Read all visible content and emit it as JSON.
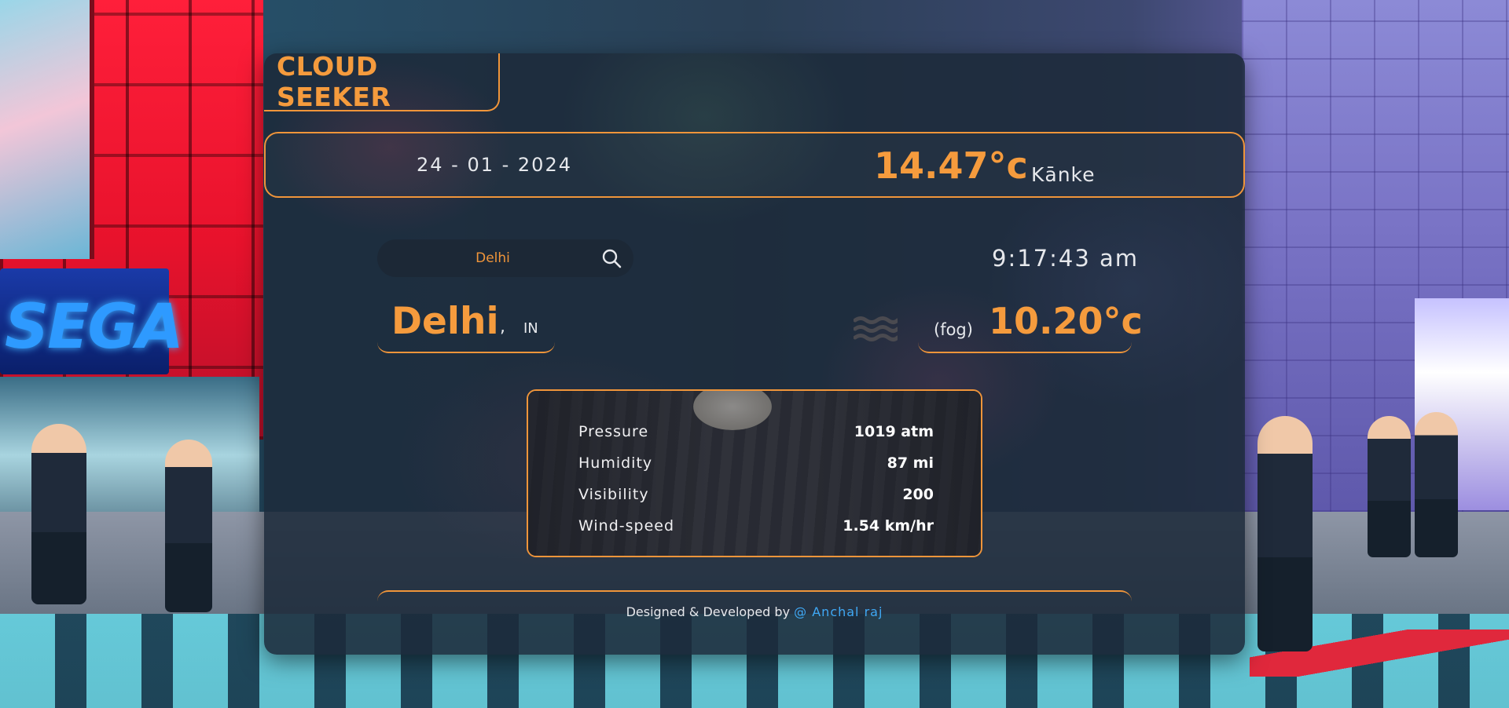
{
  "brand": {
    "title": "CLOUD SEEKER"
  },
  "topbar": {
    "date": "24 - 01 - 2024",
    "temperature": "14.47°c",
    "location": "Kānke"
  },
  "search": {
    "value": "Delhi",
    "icon": "search-icon"
  },
  "clock": {
    "time": "9:17:43 am"
  },
  "city": {
    "name": "Delhi",
    "separator": ",",
    "country": "IN"
  },
  "weather": {
    "icon": "fog-icon",
    "condition": "(fog)",
    "temperature": "10.20°c"
  },
  "stats": [
    {
      "label": "Pressure",
      "value": "1019 atm"
    },
    {
      "label": "Humidity",
      "value": "87 mi"
    },
    {
      "label": "Visibility",
      "value": "200"
    },
    {
      "label": "Wind-speed",
      "value": "1.54 km/hr"
    }
  ],
  "footer": {
    "text": "Designed & Developed by",
    "link": "@ Anchal raj"
  },
  "colors": {
    "accent": "#f59b3d",
    "link": "#3fa9f5",
    "card": "#1c2a3a"
  }
}
